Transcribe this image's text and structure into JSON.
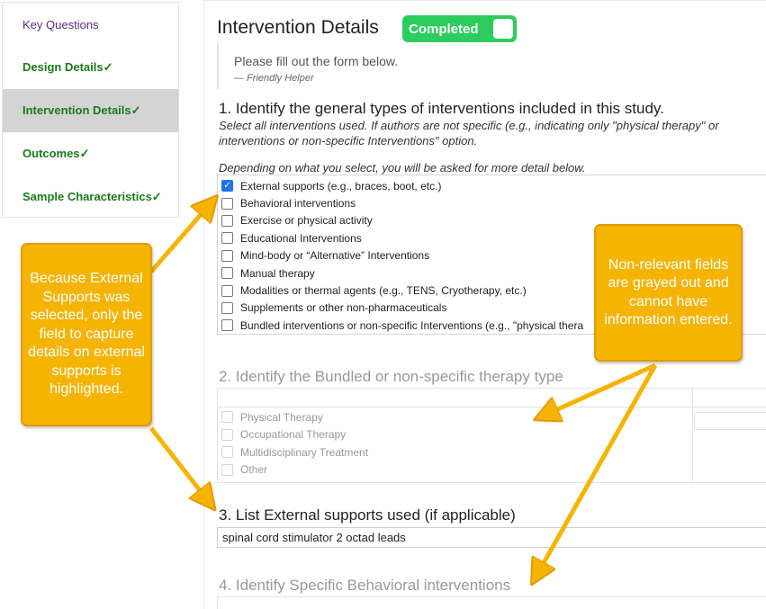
{
  "sidebar": {
    "items": [
      {
        "label": "Key Questions"
      },
      {
        "label": "Design Details✓"
      },
      {
        "label": "Intervention Details✓"
      },
      {
        "label": "Outcomes✓"
      },
      {
        "label": "Sample Characteristics✓"
      }
    ]
  },
  "header": {
    "title": "Intervention Details",
    "status_toggle": "Completed"
  },
  "helper": {
    "text": "Please fill out the form below.",
    "author": "— Friendly Helper"
  },
  "q1": {
    "title": "1. Identify the general types of interventions included in this study.",
    "help": "Select all interventions used. If authors are not specific (e.g., indicating only \"physical therapy\" or interventions or non-specific Interventions\" option.",
    "help2": "Depending on what you select, you will be asked for more detail below.",
    "options": [
      {
        "label": "External supports (e.g., braces, boot, etc.)",
        "checked": true
      },
      {
        "label": "Behavioral interventions",
        "checked": false
      },
      {
        "label": "Exercise or physical activity",
        "checked": false
      },
      {
        "label": "Educational Interventions",
        "checked": false
      },
      {
        "label": "Mind-body or “Alternative” Interventions",
        "checked": false
      },
      {
        "label": "Manual therapy",
        "checked": false
      },
      {
        "label": "Modalities or thermal agents (e.g., TENS, Cryotherapy, etc.)",
        "checked": false
      },
      {
        "label": "Supplements or other non-pharmaceuticals",
        "checked": false
      },
      {
        "label": "Bundled interventions or non-specific Interventions (e.g., \"physical thera",
        "checked": false
      }
    ]
  },
  "q2": {
    "title": "2. Identify the Bundled or non-specific therapy type",
    "options": [
      {
        "label": "Physical Therapy"
      },
      {
        "label": "Occupational Therapy"
      },
      {
        "label": "Multidisciplinary Treatment"
      },
      {
        "label": "Other"
      }
    ]
  },
  "q3": {
    "title": "3. List External supports used (if applicable)",
    "value": "spinal cord stimulator 2 octad leads"
  },
  "q4": {
    "title": "4. Identify Specific Behavioral interventions"
  },
  "callouts": {
    "left": "Because External Supports was selected, only the field to capture details on external supports is highlighted.",
    "right": "Non-relevant fields are grayed out and cannot have information entered."
  },
  "colors": {
    "accent_green": "#2dcc5f",
    "nav_done": "#1c7a1c",
    "callout": "#f5b400",
    "checkbox": "#1e73e8"
  }
}
